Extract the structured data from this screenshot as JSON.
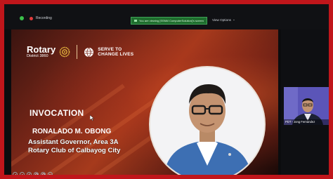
{
  "recording": {
    "label": "Recording"
  },
  "share_banner": {
    "text": "You are viewing [SSNM ComputerSolution]'s screen"
  },
  "view_options": {
    "label": "View Options",
    "caret": "⌄"
  },
  "slide": {
    "rotary": {
      "word": "Rotary",
      "district": "District 3860"
    },
    "tagline": {
      "line1": "SERVE TO",
      "line2": "CHANGE LIVES"
    },
    "heading": "INVOCATION",
    "speaker": {
      "name": "RONALADO M. OBONG",
      "title": "Assistant Governor, Area 3A",
      "org": "Rotary Club of Calbayog City"
    }
  },
  "participant": {
    "name": "PDT - Jong Fernandez"
  },
  "colors": {
    "frame": "#c0161b",
    "banner": "#1f6e2e",
    "thumb_bg": "#5a4fb0"
  }
}
